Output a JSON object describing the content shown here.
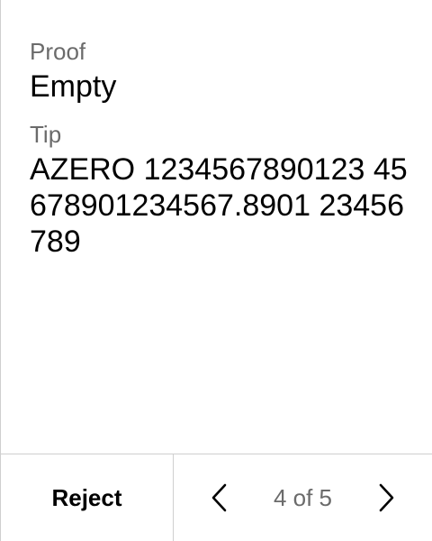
{
  "fields": [
    {
      "label": "Proof",
      "value": "Empty"
    },
    {
      "label": "Tip",
      "value": "AZERO 1234567890123 45678901234567.8901 23456789"
    }
  ],
  "footer": {
    "reject_label": "Reject",
    "page_indicator": "4 of 5",
    "prev_icon": "chevron-left-icon",
    "next_icon": "chevron-right-icon"
  },
  "colors": {
    "label": "#6b6b6b",
    "value": "#000000",
    "divider": "#cfcfcf",
    "background": "#ffffff"
  }
}
